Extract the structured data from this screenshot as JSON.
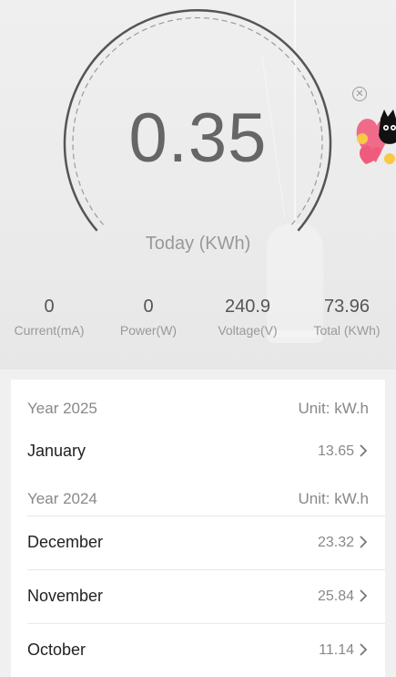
{
  "gauge": {
    "value": "0.35",
    "label": "Today (KWh)"
  },
  "stats": [
    {
      "value": "0",
      "label": "Current(mA)"
    },
    {
      "value": "0",
      "label": "Power(W)"
    },
    {
      "value": "240.9",
      "label": "Voltage(V)"
    },
    {
      "value": "73.96",
      "label": "Total (KWh)"
    }
  ],
  "ad": {
    "close_icon": "close-circle-icon",
    "sticker": "cat-heart-sticker"
  },
  "history": [
    {
      "year": "Year 2025",
      "unit": "Unit: kW.h",
      "months": [
        {
          "name": "January",
          "value": "13.65"
        }
      ]
    },
    {
      "year": "Year 2024",
      "unit": "Unit: kW.h",
      "months": [
        {
          "name": "December",
          "value": "23.32"
        },
        {
          "name": "November",
          "value": "25.84"
        },
        {
          "name": "October",
          "value": "11.14"
        }
      ]
    }
  ],
  "colors": {
    "arc": "#555555",
    "dashed_arc": "#9a9a9a",
    "card_bg": "#ffffff",
    "page_bg": "#f0f0f0"
  }
}
